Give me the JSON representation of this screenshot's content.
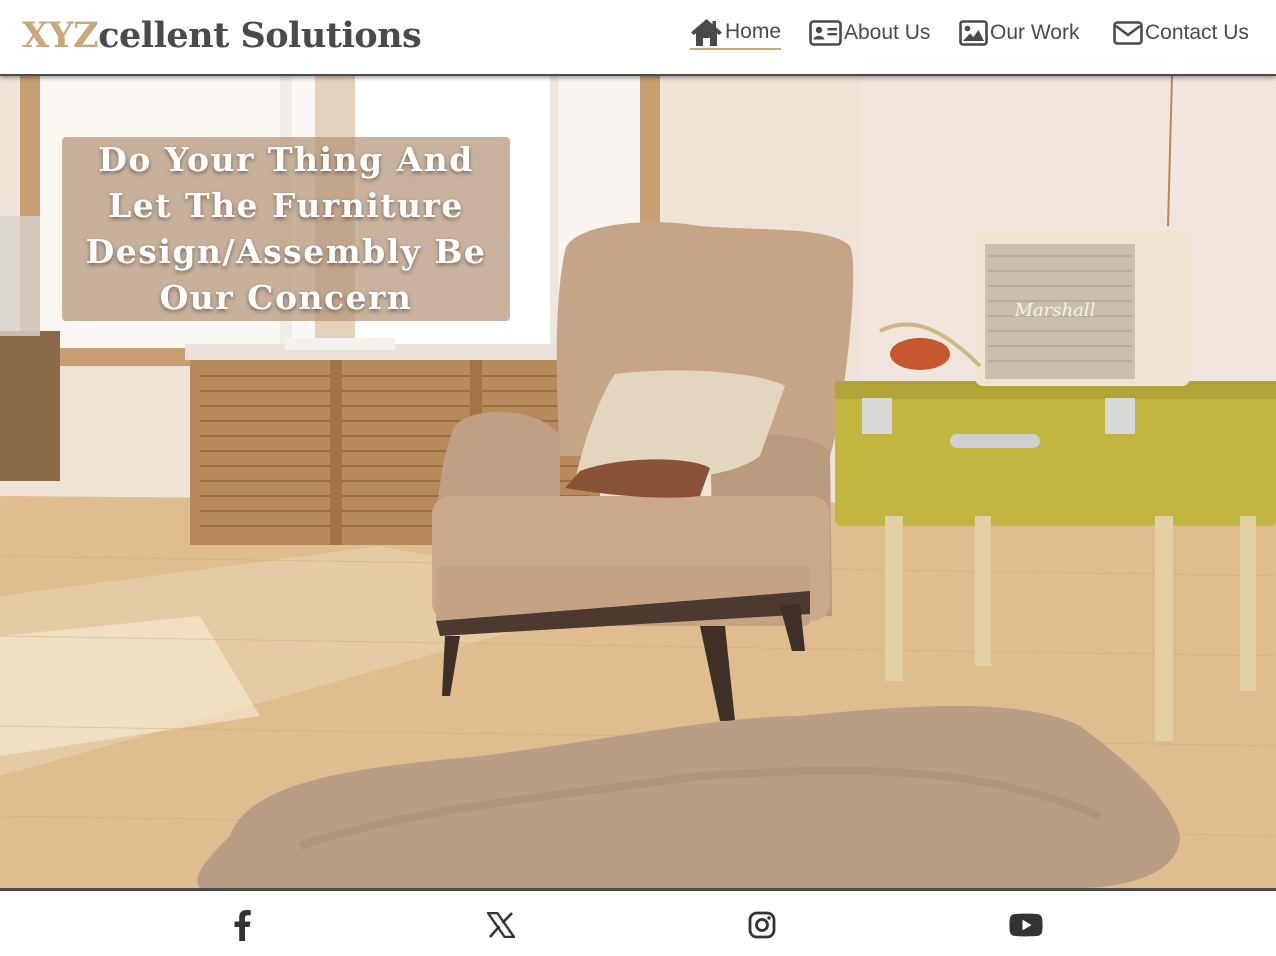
{
  "brand": {
    "accent": "XYZ",
    "rest": "cellent Solutions",
    "accent_color": "#c9a87c",
    "text_color": "#4a4a4a"
  },
  "nav": {
    "items": [
      {
        "label": "Home",
        "icon": "home-icon",
        "active": true
      },
      {
        "label": "About Us",
        "icon": "id-card-icon",
        "active": false
      },
      {
        "label": "Our Work",
        "icon": "image-icon",
        "active": false
      },
      {
        "label": "Contact Us",
        "icon": "envelope-icon",
        "active": false
      }
    ]
  },
  "hero": {
    "tagline": "Do Your Thing And Let The Furniture Design/Assembly Be Our Concern",
    "speaker_brand": "Marshall"
  },
  "footer": {
    "social": [
      {
        "name": "facebook",
        "icon": "facebook-icon"
      },
      {
        "name": "x",
        "icon": "x-icon"
      },
      {
        "name": "instagram",
        "icon": "instagram-icon"
      },
      {
        "name": "youtube",
        "icon": "youtube-icon"
      }
    ]
  }
}
